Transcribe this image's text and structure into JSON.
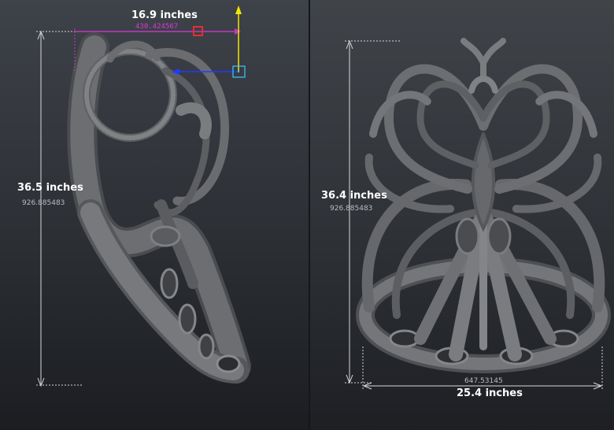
{
  "left_view": {
    "width_label": "16.9 inches",
    "width_value": "430.424567",
    "height_label": "36.5 inches",
    "height_value": "926.885483"
  },
  "right_view": {
    "height_label": "36.4 inches",
    "height_value": "926.885483",
    "width_label": "25.4 inches",
    "width_value": "647.53145"
  },
  "colors": {
    "background_top": "#3e4249",
    "background_bottom": "#1b1d21",
    "model": "#6a6c6f",
    "dimension_line": "#d8d8d8",
    "gizmo_y": "#f2e600",
    "gizmo_x": "#c03ac0",
    "gizmo_z": "#1f3cff",
    "gizmo_handle": "#e23030",
    "gizmo_center": "#3cc8ff"
  },
  "icons": {
    "transform_gizmo": "move-gizmo-icon"
  }
}
